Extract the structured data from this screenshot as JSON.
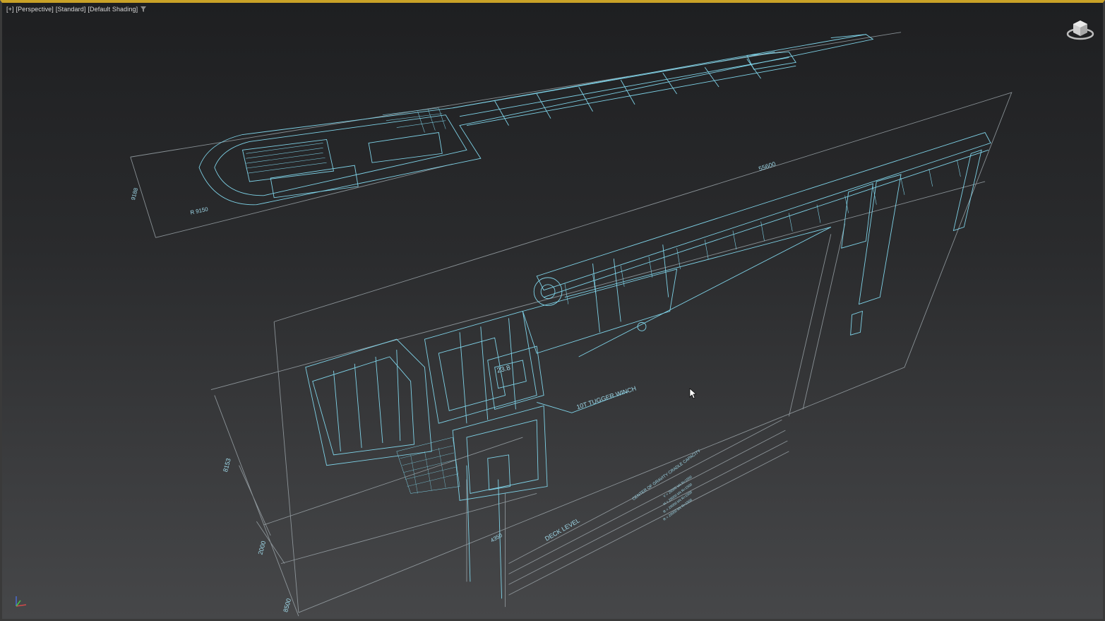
{
  "viewport": {
    "label_parts": [
      "[+]",
      "[Perspective]",
      "[Standard]",
      "[Default Shading]"
    ],
    "filter_icon": "filter-funnel-icon",
    "viewcube_icon": "viewcube-icon",
    "axis_icon": "axis-tripod-icon"
  },
  "blueprint": {
    "line_color": "#7fd3e8",
    "frame_color": "#9aa3a8",
    "top_view": {
      "dimension_length": "55600",
      "radius_label": "R 9150",
      "side_dimension": "9188"
    },
    "side_view": {
      "tugger_winch_label": "10T TUGGER WINCH",
      "section_label": "23.8",
      "deck_level_label": "DECK LEVEL",
      "cg_title": "CENTER OF GRAVITY CRADLE CAPACITY",
      "cg_lines": [
        "V = 25000 kN  R=1500",
        "H = 25000 kN  R=1500",
        "R = 25000 kN  R=1500",
        "R = 25000 kN  R=1500"
      ],
      "height_dim_1": "8153",
      "height_dim_2": "2000",
      "height_dim_3": "8500",
      "bottom_dim": "4350"
    }
  }
}
